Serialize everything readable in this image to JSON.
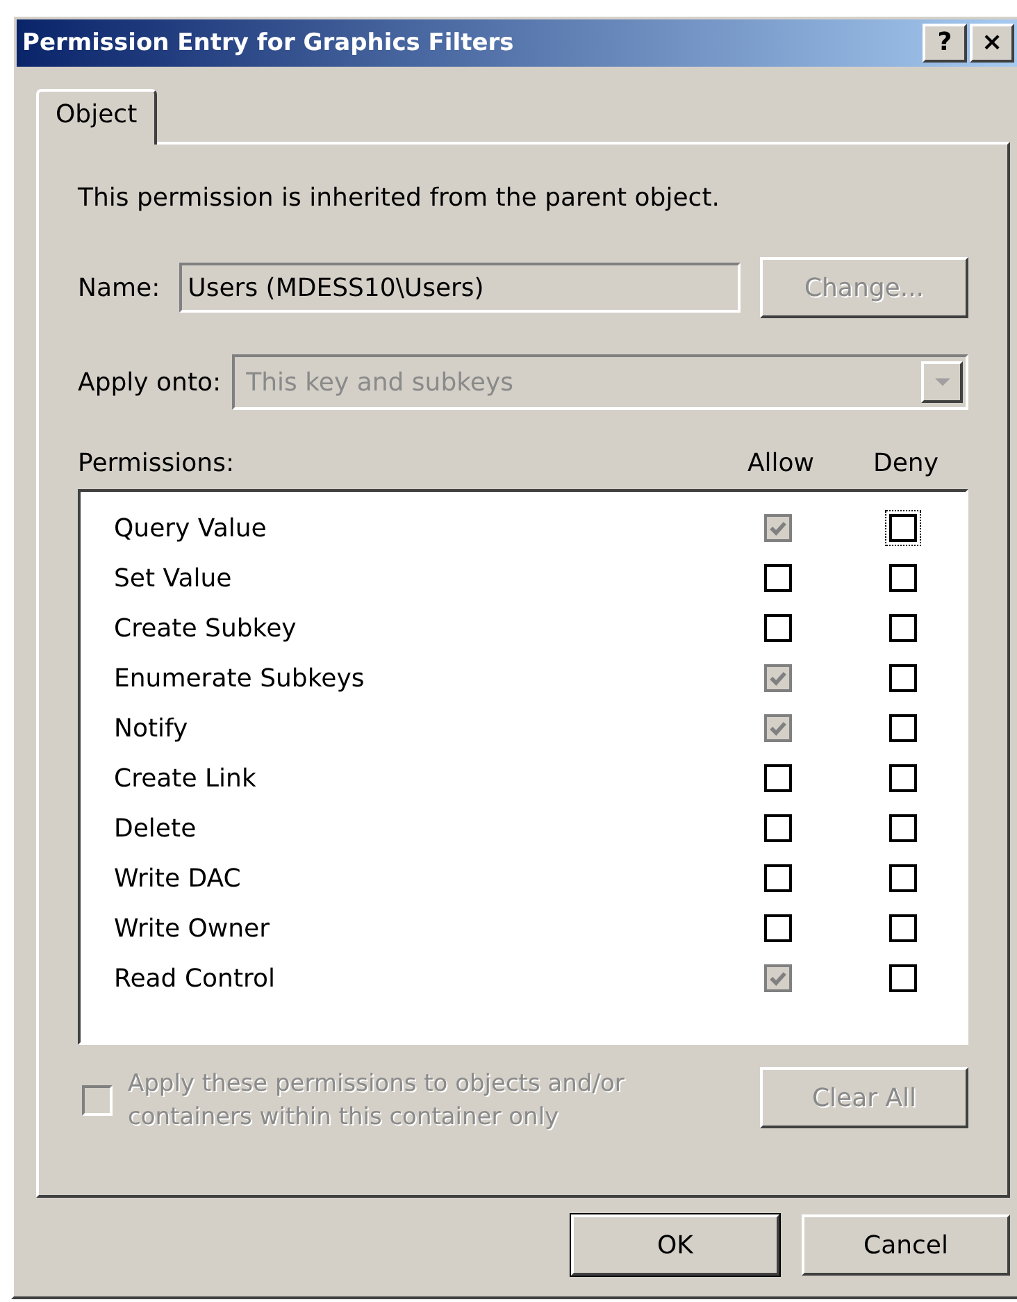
{
  "window": {
    "title": "Permission Entry for Graphics Filters",
    "help_button": "?",
    "close_button": "×"
  },
  "tabs": [
    {
      "label": "Object",
      "selected": true
    }
  ],
  "inherited_note": "This permission is inherited from the parent object.",
  "name": {
    "label": "Name:",
    "value": "Users (MDESS10\\Users)",
    "button": {
      "label": "Change...",
      "disabled": true
    }
  },
  "apply_onto": {
    "label": "Apply onto:",
    "value": "This key and subkeys",
    "disabled": true
  },
  "permissions": {
    "label": "Permissions:",
    "columns": [
      "Allow",
      "Deny"
    ],
    "rows": [
      {
        "name": "Query Value",
        "allow": {
          "checked": true,
          "disabled": true
        },
        "deny": {
          "checked": false,
          "disabled": false,
          "focused": true
        }
      },
      {
        "name": "Set Value",
        "allow": {
          "checked": false,
          "disabled": false
        },
        "deny": {
          "checked": false,
          "disabled": false,
          "focused": false
        }
      },
      {
        "name": "Create Subkey",
        "allow": {
          "checked": false,
          "disabled": false
        },
        "deny": {
          "checked": false,
          "disabled": false,
          "focused": false
        }
      },
      {
        "name": "Enumerate Subkeys",
        "allow": {
          "checked": true,
          "disabled": true
        },
        "deny": {
          "checked": false,
          "disabled": false,
          "focused": false
        }
      },
      {
        "name": "Notify",
        "allow": {
          "checked": true,
          "disabled": true
        },
        "deny": {
          "checked": false,
          "disabled": false,
          "focused": false
        }
      },
      {
        "name": "Create Link",
        "allow": {
          "checked": false,
          "disabled": false
        },
        "deny": {
          "checked": false,
          "disabled": false,
          "focused": false
        }
      },
      {
        "name": "Delete",
        "allow": {
          "checked": false,
          "disabled": false
        },
        "deny": {
          "checked": false,
          "disabled": false,
          "focused": false
        }
      },
      {
        "name": "Write DAC",
        "allow": {
          "checked": false,
          "disabled": false
        },
        "deny": {
          "checked": false,
          "disabled": false,
          "focused": false
        }
      },
      {
        "name": "Write Owner",
        "allow": {
          "checked": false,
          "disabled": false
        },
        "deny": {
          "checked": false,
          "disabled": false,
          "focused": false
        }
      },
      {
        "name": "Read Control",
        "allow": {
          "checked": true,
          "disabled": true
        },
        "deny": {
          "checked": false,
          "disabled": false,
          "focused": false
        }
      }
    ]
  },
  "apply_to_children": {
    "label": "Apply these permissions to objects and/or containers within this container only",
    "checked": false,
    "disabled": true
  },
  "clear_all": {
    "label": "Clear All",
    "disabled": true
  },
  "buttons": [
    {
      "label": "OK",
      "default": true
    },
    {
      "label": "Cancel",
      "default": false
    }
  ]
}
